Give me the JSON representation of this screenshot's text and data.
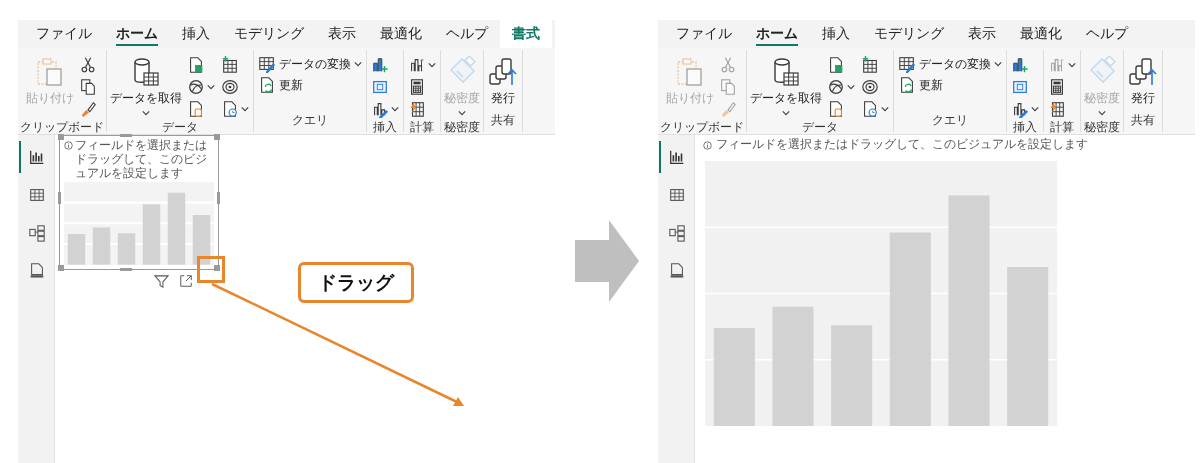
{
  "panels": [
    {
      "kind": "before",
      "tabs": [
        {
          "label": "ファイル",
          "selected": false,
          "kind": "standard"
        },
        {
          "label": "ホーム",
          "selected": true,
          "kind": "standard"
        },
        {
          "label": "挿入",
          "selected": false,
          "kind": "standard"
        },
        {
          "label": "モデリング",
          "selected": false,
          "kind": "standard"
        },
        {
          "label": "表示",
          "selected": false,
          "kind": "standard"
        },
        {
          "label": "最適化",
          "selected": false,
          "kind": "standard"
        },
        {
          "label": "ヘルプ",
          "selected": false,
          "kind": "standard"
        },
        {
          "label": "書式",
          "selected": false,
          "kind": "contextual"
        }
      ],
      "ribbon_groups": [
        {
          "label": "クリップボード",
          "items": [
            {
              "kind": "large",
              "label": "貼り付け",
              "disabled": true,
              "dropdown": false
            },
            {
              "kind": "icon",
              "disabled": false,
              "dropdown": false
            },
            {
              "kind": "icon",
              "disabled": false,
              "dropdown": false
            },
            {
              "kind": "icon",
              "disabled": false,
              "dropdown": false
            }
          ]
        },
        {
          "label": "データ",
          "items": [
            {
              "kind": "large",
              "label": "データを取得",
              "disabled": false,
              "dropdown": true
            },
            {
              "kind": "icon",
              "disabled": false,
              "dropdown": false
            },
            {
              "kind": "icon",
              "disabled": false,
              "dropdown": true
            },
            {
              "kind": "icon",
              "disabled": false,
              "dropdown": false
            },
            {
              "kind": "icon",
              "disabled": false,
              "dropdown": false
            },
            {
              "kind": "icon",
              "disabled": false,
              "dropdown": false
            },
            {
              "kind": "icon",
              "disabled": false,
              "dropdown": true
            }
          ]
        },
        {
          "label": "クエリ",
          "items": [
            {
              "kind": "small",
              "label": "データの変換",
              "disabled": false,
              "dropdown": true
            },
            {
              "kind": "small",
              "label": "更新",
              "disabled": false,
              "dropdown": false
            }
          ]
        },
        {
          "label": "挿入",
          "items": [
            {
              "kind": "icon",
              "disabled": false,
              "dropdown": false
            },
            {
              "kind": "icon",
              "disabled": false,
              "dropdown": false
            },
            {
              "kind": "icon",
              "disabled": false,
              "dropdown": true
            }
          ]
        },
        {
          "label": "計算",
          "items": [
            {
              "kind": "icon",
              "disabled": false,
              "dropdown": true
            },
            {
              "kind": "icon",
              "disabled": false,
              "dropdown": false
            },
            {
              "kind": "icon",
              "disabled": false,
              "dropdown": false
            }
          ]
        },
        {
          "label": "秘密度",
          "items": [
            {
              "kind": "large",
              "label": "秘密度",
              "disabled": true,
              "dropdown": true
            }
          ]
        },
        {
          "label": "共有",
          "items": [
            {
              "kind": "large",
              "label": "発行",
              "disabled": false,
              "dropdown": false
            }
          ]
        }
      ],
      "nav_items": [
        {
          "selected": true
        },
        {
          "selected": false
        },
        {
          "selected": false
        },
        {
          "selected": false
        }
      ],
      "visual": {
        "hint": "フィールドを選択またはドラッグして、このビジュアルを設定します",
        "selected": true
      },
      "callout": "ドラッグ"
    },
    {
      "kind": "after",
      "tabs": [
        {
          "label": "ファイル",
          "selected": false,
          "kind": "standard"
        },
        {
          "label": "ホーム",
          "selected": true,
          "kind": "standard"
        },
        {
          "label": "挿入",
          "selected": false,
          "kind": "standard"
        },
        {
          "label": "モデリング",
          "selected": false,
          "kind": "standard"
        },
        {
          "label": "表示",
          "selected": false,
          "kind": "standard"
        },
        {
          "label": "最適化",
          "selected": false,
          "kind": "standard"
        },
        {
          "label": "ヘルプ",
          "selected": false,
          "kind": "standard"
        }
      ],
      "ribbon_groups": [
        {
          "label": "クリップボード",
          "items": [
            {
              "kind": "large",
              "label": "貼り付け",
              "disabled": true,
              "dropdown": false
            },
            {
              "kind": "icon",
              "disabled": true,
              "dropdown": false
            },
            {
              "kind": "icon",
              "disabled": true,
              "dropdown": false
            },
            {
              "kind": "icon",
              "disabled": true,
              "dropdown": false
            }
          ]
        },
        {
          "label": "データ",
          "items": [
            {
              "kind": "large",
              "label": "データを取得",
              "disabled": false,
              "dropdown": true
            },
            {
              "kind": "icon",
              "disabled": false,
              "dropdown": false
            },
            {
              "kind": "icon",
              "disabled": false,
              "dropdown": true
            },
            {
              "kind": "icon",
              "disabled": false,
              "dropdown": false
            },
            {
              "kind": "icon",
              "disabled": false,
              "dropdown": false
            },
            {
              "kind": "icon",
              "disabled": false,
              "dropdown": false
            },
            {
              "kind": "icon",
              "disabled": false,
              "dropdown": true
            }
          ]
        },
        {
          "label": "クエリ",
          "items": [
            {
              "kind": "small",
              "label": "データの変換",
              "disabled": false,
              "dropdown": true
            },
            {
              "kind": "small",
              "label": "更新",
              "disabled": false,
              "dropdown": false
            }
          ]
        },
        {
          "label": "挿入",
          "items": [
            {
              "kind": "icon",
              "disabled": false,
              "dropdown": false
            },
            {
              "kind": "icon",
              "disabled": false,
              "dropdown": false
            },
            {
              "kind": "icon",
              "disabled": false,
              "dropdown": true
            }
          ]
        },
        {
          "label": "計算",
          "items": [
            {
              "kind": "icon",
              "disabled": true,
              "dropdown": true
            },
            {
              "kind": "icon",
              "disabled": false,
              "dropdown": false
            },
            {
              "kind": "icon",
              "disabled": false,
              "dropdown": false
            }
          ]
        },
        {
          "label": "秘密度",
          "items": [
            {
              "kind": "large",
              "label": "秘密度",
              "disabled": true,
              "dropdown": true
            }
          ]
        },
        {
          "label": "共有",
          "items": [
            {
              "kind": "large",
              "label": "発行",
              "disabled": false,
              "dropdown": false
            }
          ]
        }
      ],
      "nav_items": [
        {
          "selected": true
        },
        {
          "selected": false
        },
        {
          "selected": false
        },
        {
          "selected": false
        }
      ],
      "visual": {
        "hint": "フィールドを選択またはドラッグして、このビジュアルを設定します",
        "selected": false
      }
    }
  ]
}
